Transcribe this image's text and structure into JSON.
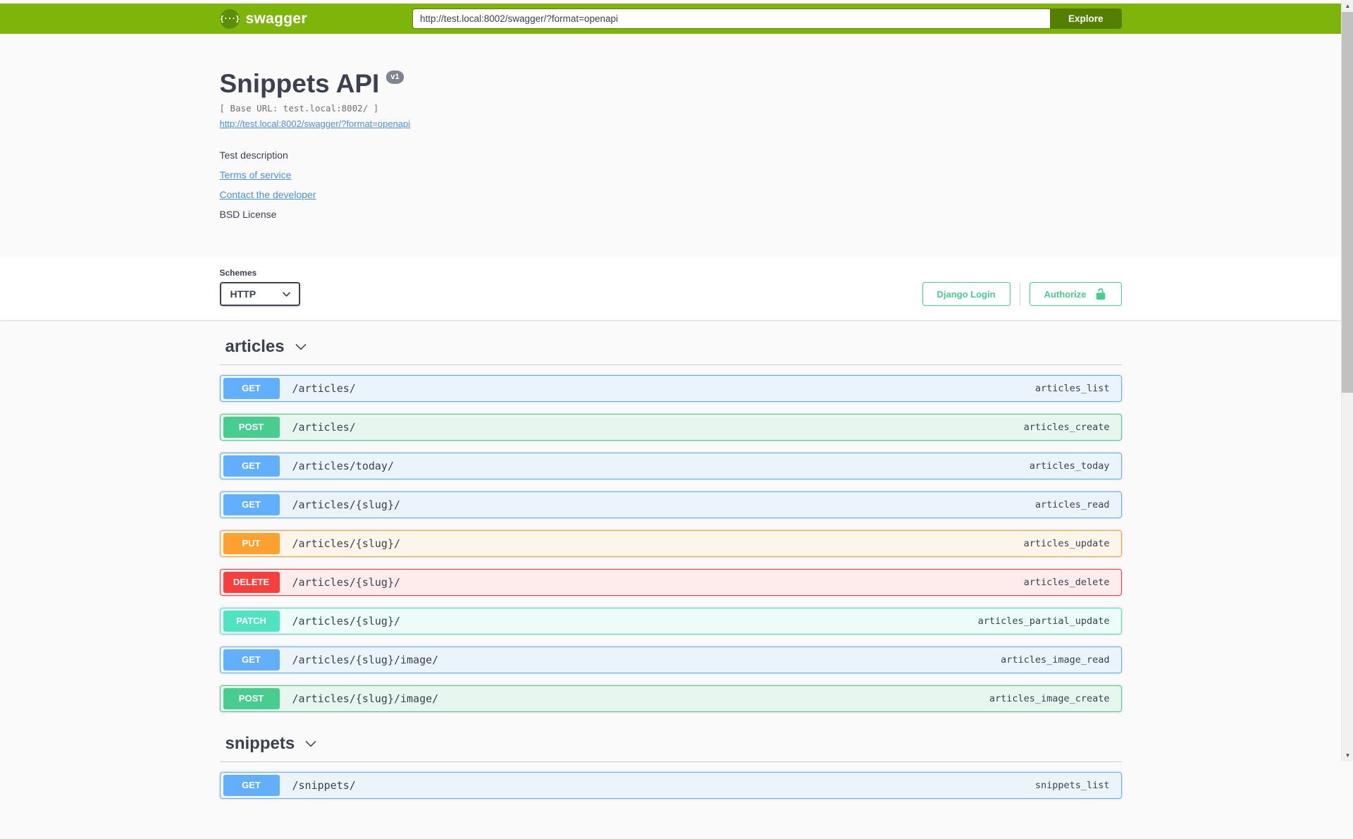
{
  "topbar": {
    "brand": "swagger",
    "url_value": "http://test.local:8002/swagger/?format=openapi",
    "explore_label": "Explore"
  },
  "info": {
    "title": "Snippets API",
    "version_badge": "v1",
    "base_url_line": "[ Base URL: test.local:8002/ ]",
    "spec_link": "http://test.local:8002/swagger/?format=openapi",
    "description": "Test description",
    "terms_label": "Terms of service",
    "contact_label": "Contact the developer",
    "license_label": "BSD License"
  },
  "scheme": {
    "label": "Schemes",
    "selected": "HTTP"
  },
  "auth": {
    "django_login_label": "Django Login",
    "authorize_label": "Authorize"
  },
  "colors": {
    "topbar_bg": "#7db50b",
    "explore_button_bg": "#547f00",
    "accent_green": "#49cc90",
    "link_blue": "#4990e2",
    "text_dark": "#3b4151",
    "version_badge_bg": "#7d8492",
    "methods": {
      "GET": "#61affe",
      "POST": "#49cc90",
      "PUT": "#fca130",
      "DELETE": "#f93e3e",
      "PATCH": "#50e3c2"
    }
  },
  "sections": [
    {
      "name": "articles",
      "operations": [
        {
          "method": "GET",
          "path": "/articles/",
          "operation_id": "articles_list"
        },
        {
          "method": "POST",
          "path": "/articles/",
          "operation_id": "articles_create"
        },
        {
          "method": "GET",
          "path": "/articles/today/",
          "operation_id": "articles_today"
        },
        {
          "method": "GET",
          "path": "/articles/{slug}/",
          "operation_id": "articles_read"
        },
        {
          "method": "PUT",
          "path": "/articles/{slug}/",
          "operation_id": "articles_update"
        },
        {
          "method": "DELETE",
          "path": "/articles/{slug}/",
          "operation_id": "articles_delete"
        },
        {
          "method": "PATCH",
          "path": "/articles/{slug}/",
          "operation_id": "articles_partial_update"
        },
        {
          "method": "GET",
          "path": "/articles/{slug}/image/",
          "operation_id": "articles_image_read"
        },
        {
          "method": "POST",
          "path": "/articles/{slug}/image/",
          "operation_id": "articles_image_create"
        }
      ]
    },
    {
      "name": "snippets",
      "operations": [
        {
          "method": "GET",
          "path": "/snippets/",
          "operation_id": "snippets_list"
        }
      ]
    }
  ]
}
